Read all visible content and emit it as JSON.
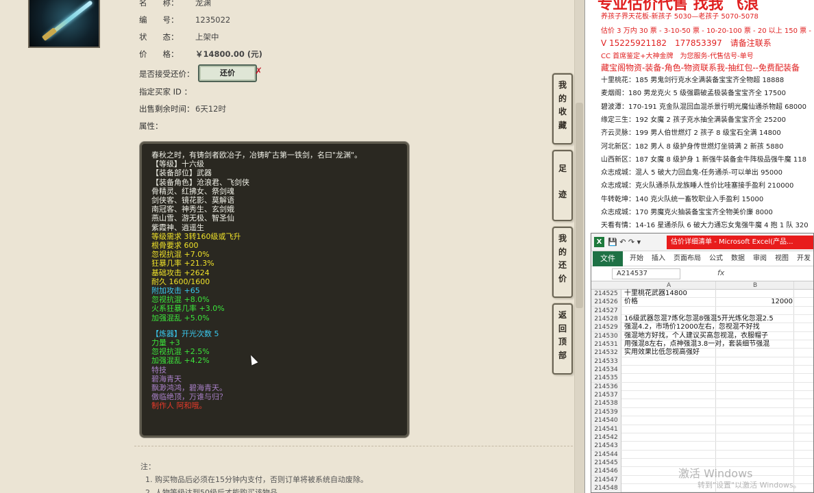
{
  "item": {
    "name_label": "名　　称：",
    "name_value": "龙渊",
    "id_label": "编　　号：",
    "id_value": "1235022",
    "status_label": "状　　态：",
    "status_value": "上架中",
    "price_label": "价　　格：",
    "price_value": "￥14800.00 (元)",
    "counter_label": "是否接受还价：",
    "counter_button": "还价",
    "buyer_label": "指定买家 ID ：",
    "time_label": "出售剩余时间：",
    "time_value": "6天12时",
    "attr_label": "属性："
  },
  "description": [
    {
      "text": "春秋之时，有铸剑者欧冶子，冶铸旷古第一铁剑，名曰\"龙渊\"。",
      "color": "white"
    },
    {
      "text": "【等级】十六级",
      "color": "white"
    },
    {
      "text": "【装备部位】武器",
      "color": "white"
    },
    {
      "text": "【装备角色】沧浪君、飞剑侠",
      "color": "white"
    },
    {
      "text": "骨精灵、红拂女、祭剑魂",
      "color": "white"
    },
    {
      "text": "剑侠客、镜花影、莫解语",
      "color": "white"
    },
    {
      "text": "南冠客、神秀生、玄剑娥",
      "color": "white"
    },
    {
      "text": "燕山雪、游无极、智圣仙",
      "color": "white"
    },
    {
      "text": "紫霞神、逍遥生",
      "color": "white"
    },
    {
      "text": "等级需求 3转160级或飞升",
      "color": "yellow"
    },
    {
      "text": "根骨要求 600",
      "color": "yellow"
    },
    {
      "text": "忽视抗混 +7.0%",
      "color": "yellow"
    },
    {
      "text": "狂暴几率 +21.3%",
      "color": "yellow"
    },
    {
      "text": "基础攻击 +2624",
      "color": "yellow"
    },
    {
      "text": "耐久 1600/1600",
      "color": "yellow"
    },
    {
      "text": "附加攻击 +65",
      "color": "blue"
    },
    {
      "text": "忽视抗混 +8.0%",
      "color": "green"
    },
    {
      "text": "火系狂暴几率 +3.0%",
      "color": "green"
    },
    {
      "text": "加强混乱 +5.0%",
      "color": "green"
    },
    {
      "text": "",
      "color": "gap"
    },
    {
      "text": "【炼器】开光次数 5",
      "color": "blue"
    },
    {
      "text": "力量 +3",
      "color": "green"
    },
    {
      "text": "忽视抗混 +2.5%",
      "color": "green"
    },
    {
      "text": "加强混乱 +4.2%",
      "color": "green"
    },
    {
      "text": "特技",
      "color": "purple"
    },
    {
      "text": "碧海青天",
      "color": "purple"
    },
    {
      "text": "飘渺鸿鸿，碧海青天。",
      "color": "purple"
    },
    {
      "text": "傲临绝顶，万谁与归？",
      "color": "purple"
    },
    {
      "text": "制作人 阿和哦。",
      "color": "red"
    }
  ],
  "notes": {
    "title": "注：",
    "items": [
      "1. 购买物品后必须在15分钟内支付，否则订单将被系统自动废除。",
      "2. 人物等级达到50级后才能购买该物品"
    ]
  },
  "side_tabs": [
    "我的收藏",
    "足迹",
    "我的还价",
    "返回顶部"
  ],
  "right_panel": {
    "title": "专业估价代售 找我 飞浪",
    "red_lines": [
      "养孩子界天花板-新孩子 5030—老孩子 5070-5078",
      "估价 3 万内 30 票 - 3-10-50 票 - 10-20-100 票 - 20 以上 150 票 - 1 票",
      "V 15225921182　177853397　请备注联系",
      "CC 首席鉴定+大神金牌　为您服务-代售估号-单号",
      "藏宝阁物资-装备-角色-物资联系我-抽红包--免费配装备"
    ],
    "rows": [
      "十里桃花：185 男鬼剑行克水全满装备宝宝齐全物超 18888",
      "麦烟阁：180 男龙克火 5 级强霸破孟极装备宝宝齐全 17500",
      "碧波潭：170-191 克金队混回血混杀景行明光魔仙通杀物超 68000",
      "缘定三生：192 女魔 2 孩子克水抽全满装备宝宝齐全 25200",
      "齐云灵脉：199 男人伯世燃灯 2 孩子 8 级宝石全满 14800",
      "河北新区：182 男人 8 级护身传世燃灯坐骑满 2 新孩 5880",
      "山西新区：187 女魔 8 级护身 1 新强牛装备金牛阵极品强牛魔 118",
      "众志成城：混人 5 破大力回血鬼-任务通杀-可以单出 95000",
      "众志成城：克火队通杀队龙族睡人性价比哇塞接手盈利 210000",
      "牛转乾坤：140 克火队统一畜牧职业入手盈利 15000",
      "众志成城：170 男魔克火抽装备宝宝齐全物美价廉 8000",
      "天看有情：14-16 星通杀队 6 破大力通忘女鬼强牛魔 4 抱 1 队 320"
    ]
  },
  "excel": {
    "caption": "估价详细清单 - Microsoft Excel(产品...",
    "file_tab": "文件",
    "tabs": [
      "开始",
      "插入",
      "页面布局",
      "公式",
      "数据",
      "审阅",
      "视图",
      "开发工"
    ],
    "name_box": "A214537",
    "fx": "fx",
    "col_a": "A",
    "col_b": "B",
    "rows": [
      {
        "n": "214525",
        "a": "十里桃花武器14800",
        "b": ""
      },
      {
        "n": "214526",
        "a": "价格",
        "b": "12000"
      },
      {
        "n": "214527",
        "a": "",
        "b": ""
      },
      {
        "n": "214528",
        "a": "16级武器忽混7炼化忽混8强混5开光炼化忽混2.5",
        "b": ""
      },
      {
        "n": "214529",
        "a": "强混4.2，市场价12000左右，忽视混不好找",
        "b": ""
      },
      {
        "n": "214530",
        "a": "强混地方好找，个人建议买高忽视混，衣服帽子",
        "b": ""
      },
      {
        "n": "214531",
        "a": "用强混8左右，点神强混3.8一对，套装细节强混",
        "b": ""
      },
      {
        "n": "214532",
        "a": "实用效果比低忽视高强好",
        "b": ""
      },
      {
        "n": "214533",
        "a": "",
        "b": ""
      },
      {
        "n": "214534",
        "a": "",
        "b": ""
      },
      {
        "n": "214535",
        "a": "",
        "b": ""
      },
      {
        "n": "214536",
        "a": "",
        "b": ""
      },
      {
        "n": "214537",
        "a": "",
        "b": ""
      },
      {
        "n": "214538",
        "a": "",
        "b": ""
      },
      {
        "n": "214539",
        "a": "",
        "b": ""
      },
      {
        "n": "214540",
        "a": "",
        "b": ""
      },
      {
        "n": "214541",
        "a": "",
        "b": ""
      },
      {
        "n": "214542",
        "a": "",
        "b": ""
      },
      {
        "n": "214543",
        "a": "",
        "b": ""
      },
      {
        "n": "214544",
        "a": "",
        "b": ""
      },
      {
        "n": "214545",
        "a": "",
        "b": ""
      },
      {
        "n": "214546",
        "a": "",
        "b": ""
      },
      {
        "n": "214547",
        "a": "",
        "b": ""
      },
      {
        "n": "214548",
        "a": "",
        "b": ""
      }
    ]
  },
  "watermark": {
    "line1": "激活 Windows",
    "line2": "转到\"设置\"以激活 Windows。"
  }
}
